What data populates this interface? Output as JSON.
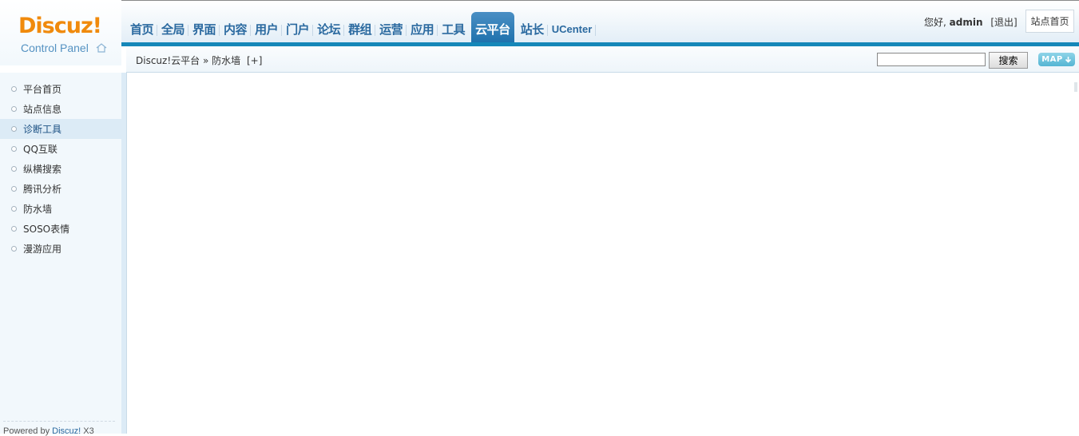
{
  "logo": {
    "brand": "Discuz!",
    "subtitle": "Control Panel"
  },
  "nav": [
    {
      "label": "首页"
    },
    {
      "label": "全局"
    },
    {
      "label": "界面"
    },
    {
      "label": "内容"
    },
    {
      "label": "用户"
    },
    {
      "label": "门户"
    },
    {
      "label": "论坛"
    },
    {
      "label": "群组"
    },
    {
      "label": "运营"
    },
    {
      "label": "应用"
    },
    {
      "label": "工具"
    },
    {
      "label": "云平台",
      "active": true
    },
    {
      "label": "站长"
    },
    {
      "label": "UCenter"
    }
  ],
  "user": {
    "greeting": "您好,",
    "name": "admin",
    "logout": "[退出]"
  },
  "site_home": "站点首页",
  "breadcrumb": {
    "path": "Discuz!云平台 » 防水墙",
    "add": "[+]"
  },
  "search": {
    "value": "",
    "button": "搜索"
  },
  "map_button": "MAP",
  "sidebar": {
    "items": [
      {
        "label": "平台首页"
      },
      {
        "label": "站点信息"
      },
      {
        "label": "诊断工具",
        "active": true
      },
      {
        "label": "QQ互联"
      },
      {
        "label": "纵横搜索"
      },
      {
        "label": "腾讯分析"
      },
      {
        "label": "防水墙"
      },
      {
        "label": "SOSO表情"
      },
      {
        "label": "漫游应用"
      }
    ],
    "footer_prefix": "Powered by ",
    "footer_link": "Discuz!",
    "footer_suffix": " X3"
  },
  "colors": {
    "accent": "#1587b9",
    "logo": "#f08a0c",
    "nav_text": "#2b6aa0"
  }
}
